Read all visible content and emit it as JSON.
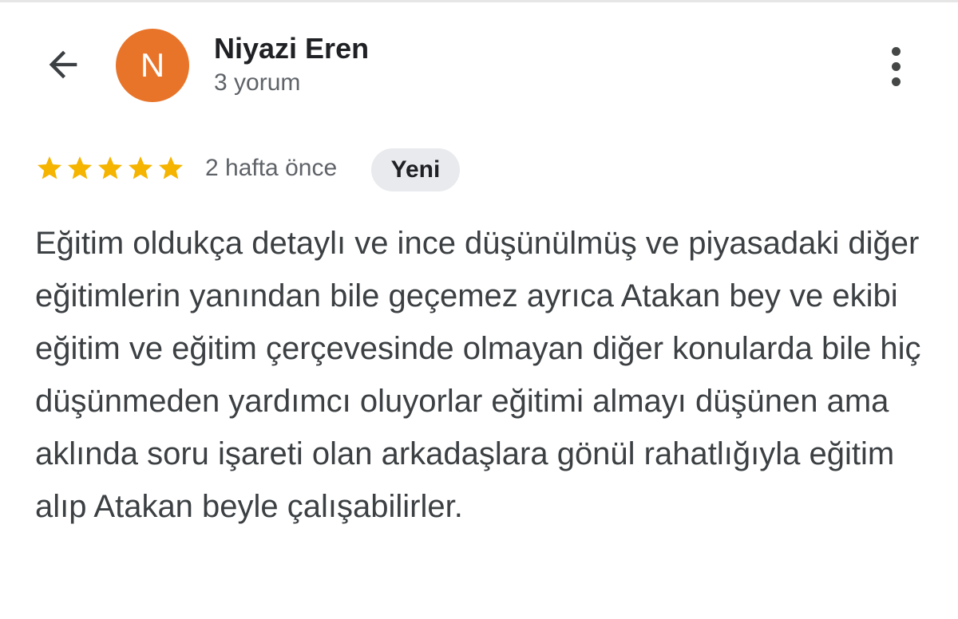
{
  "reviewer": {
    "avatar_letter": "N",
    "avatar_color": "#e8742a",
    "name": "Niyazi Eren",
    "review_count": "3 yorum"
  },
  "review": {
    "rating": 5,
    "max_rating": 5,
    "date": "2 hafta önce",
    "badge": "Yeni",
    "text": "Eğitim oldukça detaylı ve ince düşünülmüş ve piyasadaki diğer eğitimlerin yanından bile geçemez ayrıca Atakan bey ve ekibi eğitim ve eğitim çerçevesinde olmayan diğer konularda bile hiç düşünmeden yardımcı oluyorlar eğitimi almayı düşünen ama aklında soru işareti olan arkadaşlara gönül rahatlığıyla eğitim alıp Atakan beyle çalışabilirler."
  },
  "icons": {
    "back": "arrow-back-icon",
    "more": "more-vertical-icon",
    "star": "star-icon"
  },
  "colors": {
    "star": "#f5b400",
    "badge_bg": "#e8eaed"
  }
}
